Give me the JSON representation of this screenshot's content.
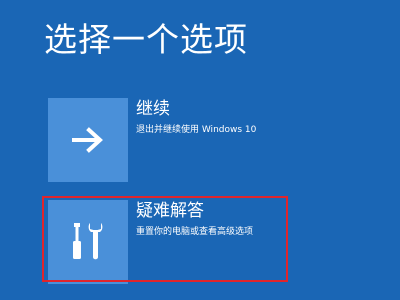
{
  "page": {
    "title": "选择一个选项",
    "background_color": "#1a66b5",
    "tile_color": "#4a90d9",
    "highlight_color": "#e0252b"
  },
  "options": [
    {
      "icon": "arrow-right-icon",
      "title": "继续",
      "description": "退出并继续使用 Windows 10"
    },
    {
      "icon": "tools-icon",
      "title": "疑难解答",
      "description": "重置你的电脑或查看高级选项",
      "highlighted": true
    }
  ]
}
